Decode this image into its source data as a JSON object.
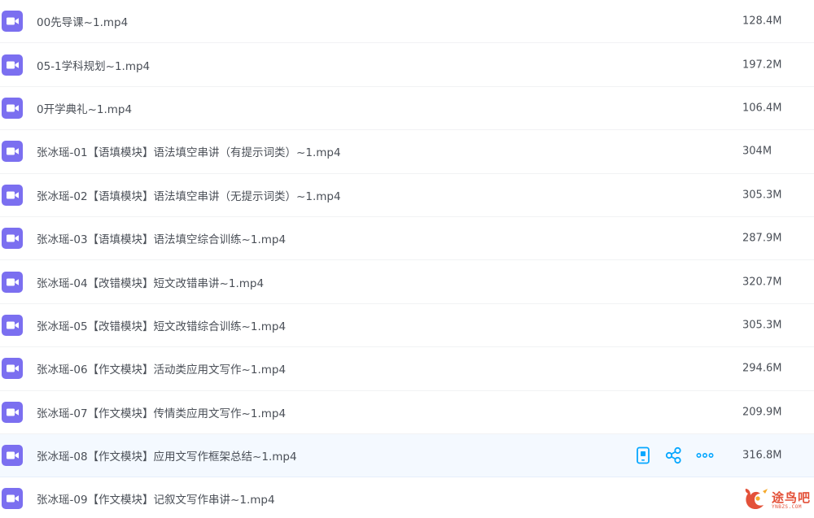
{
  "colors": {
    "video_icon": "#7b6ff0",
    "action_icon": "#06a7ff",
    "row_hover": "#f4f9ff",
    "watermark": "#e2482f"
  },
  "files": [
    {
      "name": "00先导课~1.mp4",
      "size": "128.4M",
      "icon": "video-file-icon"
    },
    {
      "name": "05-1学科规划~1.mp4",
      "size": "197.2M",
      "icon": "video-file-icon"
    },
    {
      "name": "0开学典礼~1.mp4",
      "size": "106.4M",
      "icon": "video-file-icon"
    },
    {
      "name": "张冰瑶-01【语填模块】语法填空串讲（有提示词类）~1.mp4",
      "size": "304M",
      "icon": "video-file-icon"
    },
    {
      "name": "张冰瑶-02【语填模块】语法填空串讲（无提示词类）~1.mp4",
      "size": "305.3M",
      "icon": "video-file-icon"
    },
    {
      "name": "张冰瑶-03【语填模块】语法填空综合训练~1.mp4",
      "size": "287.9M",
      "icon": "video-file-icon"
    },
    {
      "name": "张冰瑶-04【改错模块】短文改错串讲~1.mp4",
      "size": "320.7M",
      "icon": "video-file-icon"
    },
    {
      "name": "张冰瑶-05【改错模块】短文改错综合训练~1.mp4",
      "size": "305.3M",
      "icon": "video-file-icon"
    },
    {
      "name": "张冰瑶-06【作文模块】活动类应用文写作~1.mp4",
      "size": "294.6M",
      "icon": "video-file-icon"
    },
    {
      "name": "张冰瑶-07【作文模块】传情类应用文写作~1.mp4",
      "size": "209.9M",
      "icon": "video-file-icon"
    },
    {
      "name": "张冰瑶-08【作文模块】应用文写作框架总结~1.mp4",
      "size": "316.8M",
      "icon": "video-file-icon",
      "hovered": true,
      "actions": [
        "phone-icon",
        "share-icon",
        "more-icon"
      ]
    },
    {
      "name": "张冰瑶-09【作文模块】记叙文写作串讲~1.mp4",
      "size": "",
      "icon": "video-file-icon"
    }
  ],
  "watermark": {
    "text": "途鸟吧",
    "sub": "YNBZS.COM"
  }
}
